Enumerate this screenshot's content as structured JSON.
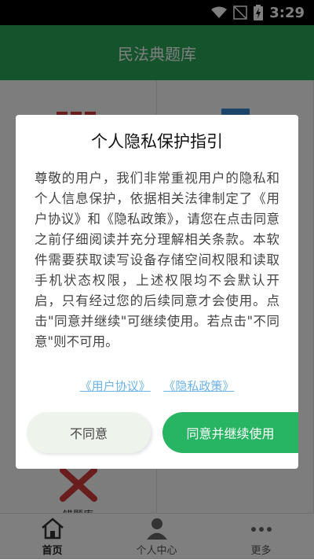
{
  "status_bar": {
    "time": "3:29"
  },
  "app": {
    "title": "民法典题库"
  },
  "grid": {
    "visible_label": "错题库"
  },
  "dialog": {
    "title": "个人隐私保护指引",
    "body": "尊敬的用户，我们非常重视用户的隐私和个人信息保护，依据相关法律制定了《用户协议》和《隐私政策》，请您在点击同意之前仔细阅读并充分理解相关条款。本软件需要获取读写设备存储空间权限和读取手机状态权限，上述权限均不会默认开启，只有经过您的后续同意才会使用。点击\"同意并继续\"可继续使用。若点击\"不同意\"则不可用。",
    "link_user_agreement": "《用户协议》",
    "link_privacy_policy": "《隐私政策》",
    "disagree_label": "不同意",
    "agree_label": "同意并继续使用"
  },
  "bottom_nav": {
    "home": "首页",
    "profile": "个人中心",
    "more": "更多"
  },
  "colors": {
    "brand_green": "#2aa65a",
    "link_blue": "#6db4e6"
  }
}
